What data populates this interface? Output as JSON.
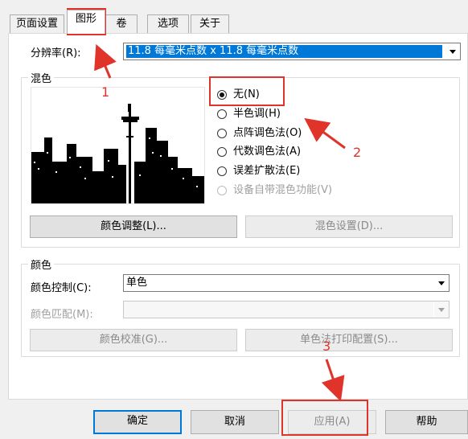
{
  "tabs": [
    {
      "label": "页面设置"
    },
    {
      "label": "图形"
    },
    {
      "label": "卷"
    },
    {
      "label": "选项"
    },
    {
      "label": "关于"
    }
  ],
  "resolution": {
    "label": "分辨率(R):",
    "value": "11.8 每毫米点数 x 11.8 每毫米点数"
  },
  "dithering": {
    "title": "混色",
    "options": [
      {
        "label": "无(N)",
        "checked": true,
        "enabled": true
      },
      {
        "label": "半色调(H)",
        "checked": false,
        "enabled": true
      },
      {
        "label": "点阵调色法(O)",
        "checked": false,
        "enabled": true
      },
      {
        "label": "代数调色法(A)",
        "checked": false,
        "enabled": true
      },
      {
        "label": "误差扩散法(E)",
        "checked": false,
        "enabled": true
      },
      {
        "label": "设备自带混色功能(V)",
        "checked": false,
        "enabled": false
      }
    ],
    "color_adjust_btn": "颜色调整(L)...",
    "dither_settings_btn": "混色设置(D)..."
  },
  "color": {
    "title": "颜色",
    "control_label": "颜色控制(C):",
    "control_value": "单色",
    "match_label": "颜色匹配(M):",
    "match_value": "",
    "calibrate_btn": "颜色校准(G)...",
    "mono_config_btn": "单色法打印配置(S)..."
  },
  "footer": {
    "ok": "确定",
    "cancel": "取消",
    "apply": "应用(A)",
    "help": "帮助"
  },
  "annotations": {
    "n1": "1",
    "n2": "2",
    "n3": "3",
    "color": "#e0342a"
  }
}
